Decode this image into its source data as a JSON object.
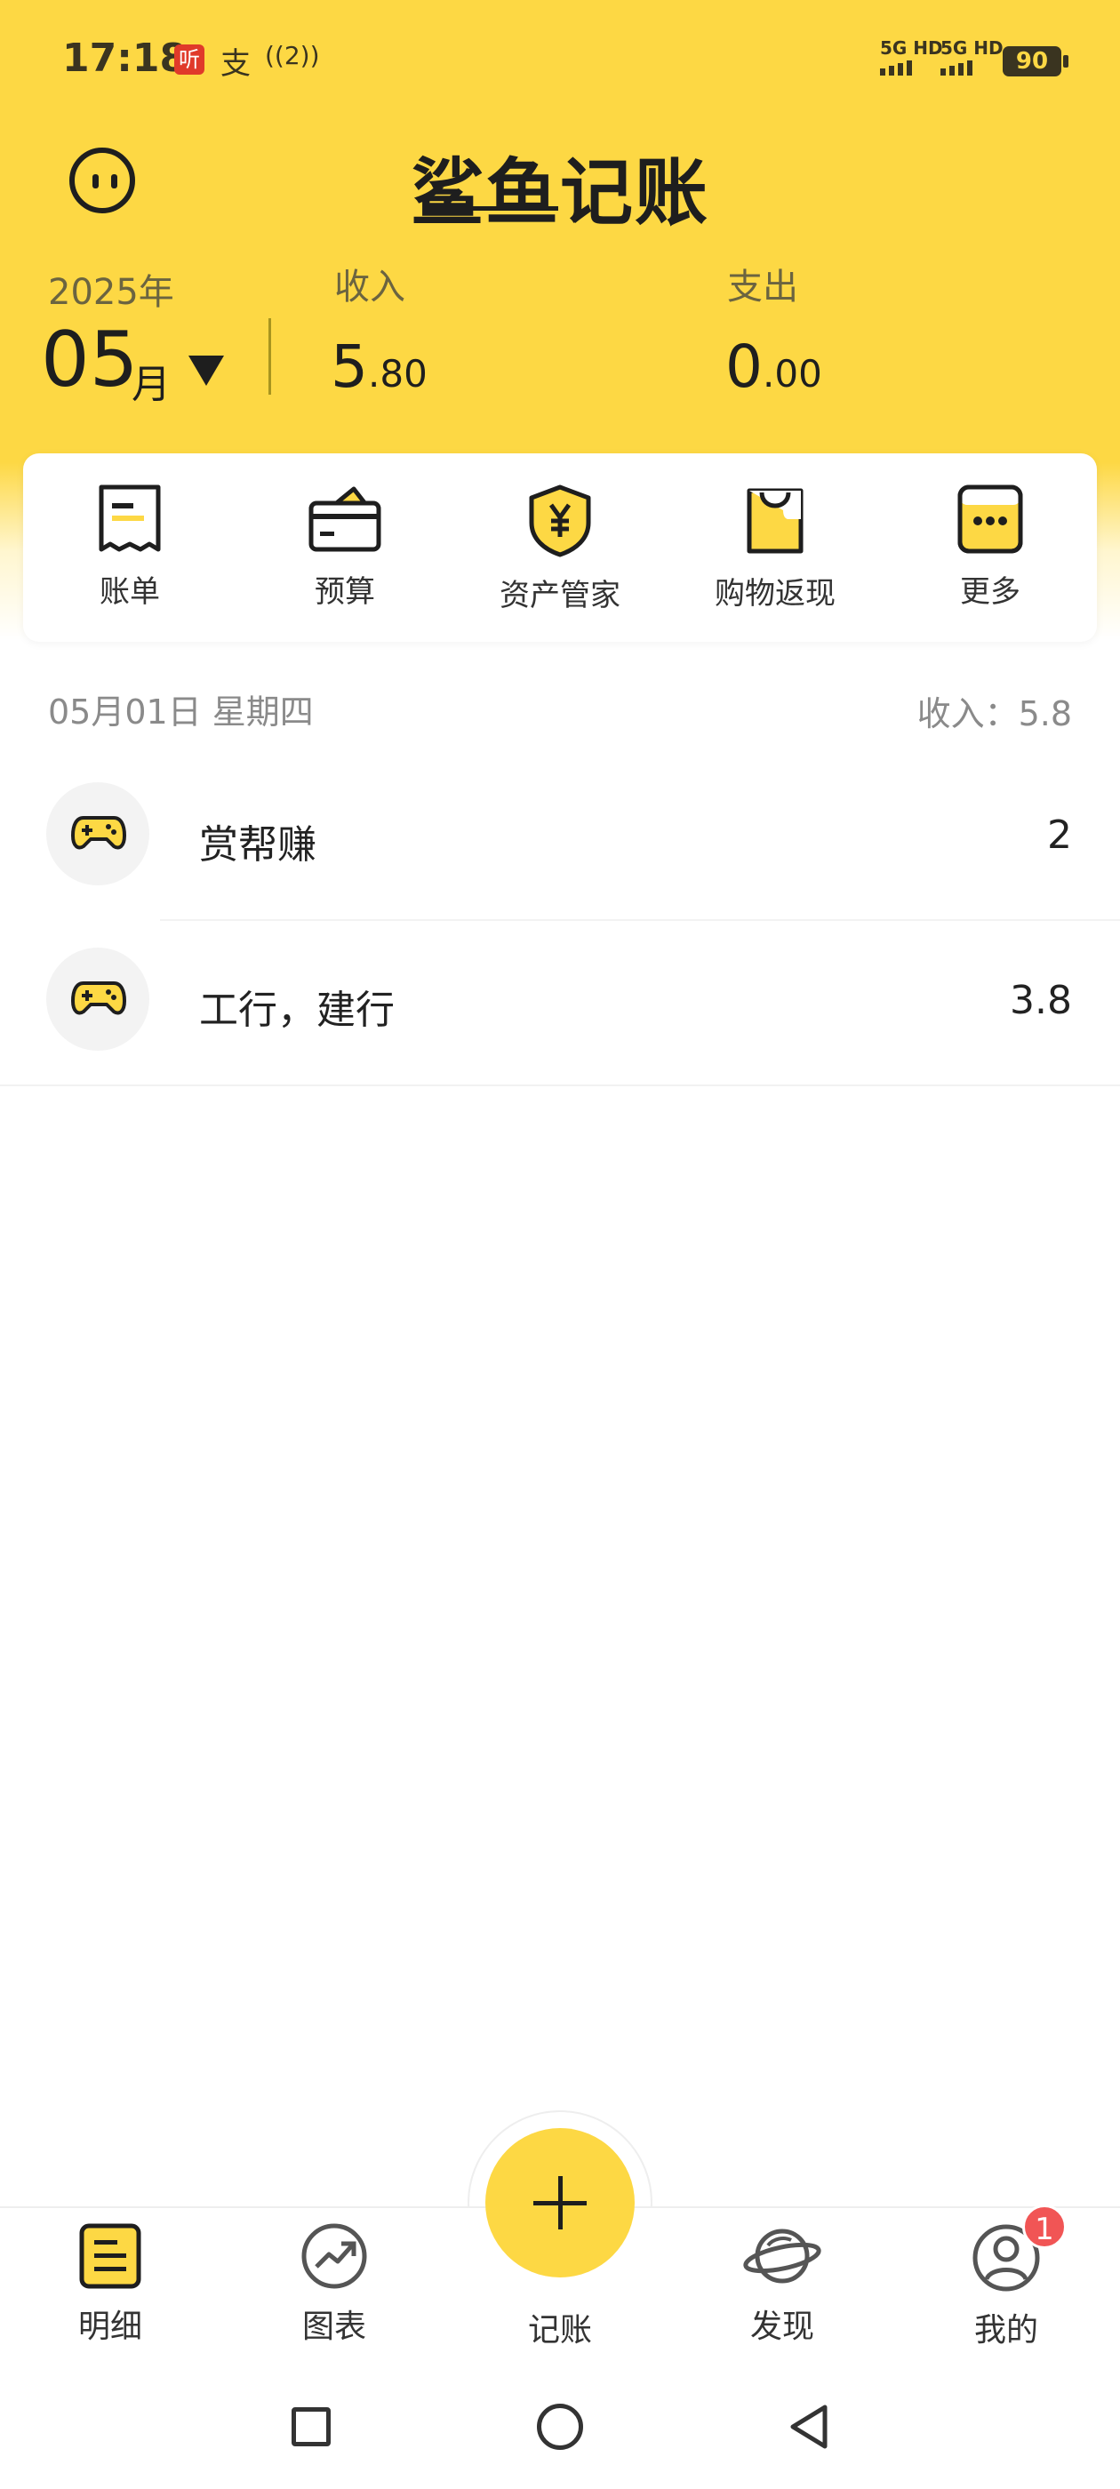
{
  "status_bar": {
    "time": "17:18",
    "ting_badge": "听",
    "zhi_icon": "支",
    "wifi_icon": "((2))",
    "network1": "5G HD",
    "network2": "5G HD",
    "battery": "90"
  },
  "header": {
    "app_title": "鲨鱼记账",
    "year": "2025年",
    "month": "05",
    "month_suffix": "月",
    "income_label": "收入",
    "income_int": "5",
    "income_dec": ".80",
    "expense_label": "支出",
    "expense_int": "0",
    "expense_dec": ".00"
  },
  "features": [
    {
      "label": "账单",
      "icon": "receipt-icon"
    },
    {
      "label": "预算",
      "icon": "wallet-icon"
    },
    {
      "label": "资产管家",
      "icon": "shield-yen-icon"
    },
    {
      "label": "购物返现",
      "icon": "shopping-bag-icon"
    },
    {
      "label": "更多",
      "icon": "more-icon"
    }
  ],
  "day_group": {
    "date": "05月01日 星期四",
    "income_summary": "收入：5.8",
    "records": [
      {
        "name": "赏帮赚",
        "amount": "2",
        "icon": "gamepad-icon"
      },
      {
        "name": "工行，建行",
        "amount": "3.8",
        "icon": "gamepad-icon"
      }
    ]
  },
  "bottom_nav": {
    "items": [
      {
        "label": "明细",
        "icon": "list-icon"
      },
      {
        "label": "图表",
        "icon": "chart-icon"
      },
      {
        "label": "记账",
        "icon": "plus-icon"
      },
      {
        "label": "发现",
        "icon": "planet-icon"
      },
      {
        "label": "我的",
        "icon": "profile-icon"
      }
    ],
    "profile_badge": "1"
  },
  "colors": {
    "brand_yellow": "#FDD844",
    "badge_red": "#F15555"
  }
}
